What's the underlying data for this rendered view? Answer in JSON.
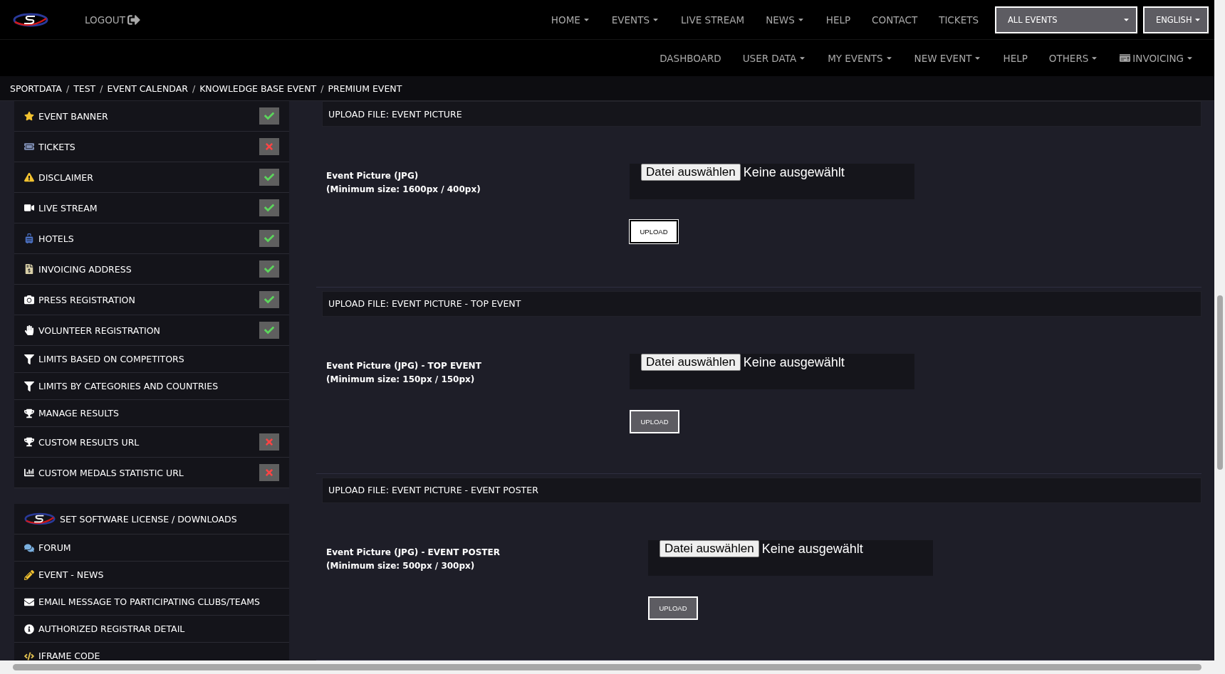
{
  "top_nav": {
    "logout": "LOGOUT",
    "items": [
      {
        "label": "HOME",
        "dropdown": true
      },
      {
        "label": "EVENTS",
        "dropdown": true
      },
      {
        "label": "LIVE STREAM",
        "dropdown": false
      },
      {
        "label": "NEWS",
        "dropdown": true
      },
      {
        "label": "HELP",
        "dropdown": false
      },
      {
        "label": "CONTACT",
        "dropdown": false
      },
      {
        "label": "TICKETS",
        "dropdown": false
      }
    ],
    "event_select": "ALL EVENTS",
    "language_select": "ENGLISH"
  },
  "sub_nav": {
    "items": [
      {
        "label": "DASHBOARD",
        "dropdown": false
      },
      {
        "label": "USER DATA",
        "dropdown": true
      },
      {
        "label": "MY EVENTS",
        "dropdown": true
      },
      {
        "label": "NEW EVENT",
        "dropdown": true
      },
      {
        "label": "HELP",
        "dropdown": false
      },
      {
        "label": "OTHERS",
        "dropdown": true
      },
      {
        "label": "INVOICING",
        "dropdown": true
      }
    ]
  },
  "breadcrumb": [
    {
      "label": "SPORTDATA",
      "separator": "/"
    },
    {
      "label": "TEST",
      "separator": "/"
    },
    {
      "label": "EVENT CALENDAR",
      "separator": "/"
    },
    {
      "label": "KNOWLEDGE BASE EVENT",
      "separator": "/"
    },
    {
      "label": "PREMIUM EVENT"
    }
  ],
  "sidebar": {
    "groups": [
      {
        "items": [
          {
            "label": "EVENT BANNER",
            "complete": true
          },
          {
            "label": "TICKETS",
            "complete": false
          },
          {
            "label": "DISCLAIMER",
            "complete": true
          },
          {
            "label": "LIVE STREAM",
            "complete": true
          },
          {
            "label": "HOTELS",
            "complete": true
          },
          {
            "label": "INVOICING ADDRESS",
            "complete": true
          },
          {
            "label": "PRESS REGISTRATION",
            "complete": true
          },
          {
            "label": "VOLUNTEER REGISTRATION",
            "complete": true
          },
          {
            "label": "LIMITS BASED ON COMPETITORS"
          },
          {
            "label": "LIMITS BY CATEGORIES AND COUNTRIES"
          },
          {
            "label": "MANAGE RESULTS"
          },
          {
            "label": "CUSTOM RESULTS URL",
            "complete": false
          },
          {
            "label": "CUSTOM MEDALS STATISTIC URL",
            "complete": false
          }
        ]
      },
      {
        "items": [
          {
            "label": "SET SOFTWARE LICENSE / DOWNLOADS"
          },
          {
            "label": "FORUM"
          },
          {
            "label": "EVENT - NEWS"
          },
          {
            "label": "EMAIL MESSAGE TO PARTICIPATING CLUBS/TEAMS"
          },
          {
            "label": "AUTHORIZED REGISTRAR DETAIL"
          },
          {
            "label": "IFRAME CODE"
          }
        ]
      }
    ]
  },
  "uploads": [
    {
      "title": "UPLOAD FILE: EVENT PICTURE",
      "label": [
        "Event Picture (JPG)",
        "(Minimum size: 1600px / 400px)"
      ],
      "choose_button": "Datei auswählen",
      "file_status": "Keine ausgewählt",
      "upload_button": "UPLOAD",
      "highlighted": true
    },
    {
      "title": "UPLOAD FILE: EVENT PICTURE - TOP EVENT",
      "label": [
        "Event Picture (JPG) - TOP EVENT",
        "(Minimum size: 150px / 150px)"
      ],
      "choose_button": "Datei auswählen",
      "file_status": "Keine ausgewählt",
      "upload_button": "UPLOAD",
      "highlighted": false
    },
    {
      "title": "UPLOAD FILE: EVENT PICTURE - EVENT POSTER",
      "label": [
        "Event Picture (JPG) - EVENT POSTER",
        "(Minimum size: 500px / 300px)"
      ],
      "choose_button": "Datei auswählen",
      "file_status": "Keine ausgewählt",
      "upload_button": "UPLOAD",
      "highlighted": false
    }
  ]
}
